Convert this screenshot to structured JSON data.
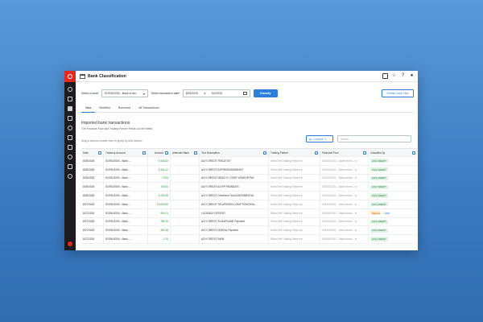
{
  "window": {
    "title": "Bank Classification",
    "toolbar_icons": [
      "calendar-icon",
      "star-icon",
      "help-icon",
      "user-icon"
    ]
  },
  "filters": {
    "bank_label": "Select a bank*",
    "bank_value": "SOFAUSON - Bank of Am...",
    "date_label": "Select transaction date*",
    "date_from": "8/23/2026",
    "date_to": "9/1/2026",
    "classify_label": "Classify",
    "publish_label": "Publish Cash Flow"
  },
  "tabs": [
    "New",
    "Modified",
    "Removed",
    "All Transactions"
  ],
  "section": {
    "title": "Imported bank transactions",
    "subtitle": "The Financial Flow and Trading Partner Fields can be edited.",
    "group_hint": "Drag a column header here to group by that column",
    "columns_label": "Columns",
    "search_placeholder": "Search"
  },
  "grid": {
    "headers": [
      "Date",
      "Treasury Account",
      "Amount",
      "Alternate Bank",
      "Text Description",
      "Trading Partner",
      "Financial Flow",
      "Classified by"
    ],
    "rows": [
      {
        "date": "8/26/2026",
        "account": "SOFAUSON - Bank ...",
        "amount": "4,004.52",
        "desc": "ACH CREDIT TRACE KIT",
        "partner": "Select the Trading Partner",
        "flow": "0151010101 - Sales reven...",
        "class": "ACH CREDIT",
        "status": "ok"
      },
      {
        "date": "8/26/2026",
        "account": "SOFAUSON - Bank ...",
        "amount": "4,444.12",
        "desc": "ACH CREDIT EXPRESS/ANDHI/INT",
        "partner": "Select the Trading Partner",
        "flow": "0151010101 - Sales reven...",
        "class": "ACH CREDIT",
        "status": "ok"
      },
      {
        "date": "8/26/2026",
        "account": "SOFAUSON - Bank ...",
        "amount": "70.84",
        "desc": "ACH CREDIT NEWCYC CORE VENDOR PAY",
        "partner": "Select the Trading Partner",
        "flow": "0151010101 - Sales reven...",
        "class": "ACH CREDIT",
        "status": "ok"
      },
      {
        "date": "8/26/2026",
        "account": "SOFAUSON - Bank ...",
        "amount": "100.51",
        "desc": "ACH CREDIT ACH/P PAYABLES",
        "partner": "Select the Trading Partner",
        "flow": "0151010101 - Sales reven...",
        "class": "ACH CREDIT",
        "status": "ok"
      },
      {
        "date": "8/26/2026",
        "account": "SOFAUSON - Bank ...",
        "amount": "1,240.99",
        "desc": "ACH CREDIT Cleveland Trust INVESMENTAL",
        "partner": "Select the Trading Partner",
        "flow": "0151010101 - Sales reven...",
        "class": "ACH CREDIT",
        "status": "ok"
      },
      {
        "date": "8/27/2026",
        "account": "SOFAUSON - Bank ...",
        "amount": "13,829.90",
        "desc": "ACH CREDIT TELUPNSEN COMP PONCHVA...",
        "partner": "Select the Trading Partner",
        "flow": "0151010101 - Sales reven...",
        "class": "ACH CREDIT",
        "status": "ok"
      },
      {
        "date": "8/27/2026",
        "account": "SOFAUSON - Bank ...",
        "amount": "994.01",
        "desc": "LOCKBOX DEPOSIT",
        "partner": "Select the Trading Partner",
        "flow": "0151010101 - Sales reven...",
        "class": "Manual",
        "status": "warn",
        "action": "Clear"
      },
      {
        "date": "8/27/2026",
        "account": "SOFAUSON - Bank ...",
        "amount": "786.20",
        "desc": "ACH CREDIT SUGARCANE Payment",
        "partner": "Select the Trading Partner",
        "flow": "0151010101 - Sales reven...",
        "class": "ACH CREDIT",
        "status": "ok"
      },
      {
        "date": "8/27/2026",
        "account": "SOFAUSON - Bank ...",
        "amount": "480.38",
        "desc": "ACH CREDIT DENTAL Payment",
        "partner": "Select the Trading Partner",
        "flow": "0151010101 - Sales reven...",
        "class": "ACH CREDIT",
        "status": "ok"
      },
      {
        "date": "8/27/2026",
        "account": "SOFAUSON - Bank ...",
        "amount": "1.76",
        "desc": "ACH CREDIT INEM",
        "partner": "Select the Trading Partner",
        "flow": "0151010101 - Sales reven...",
        "class": "ACH CREDIT",
        "status": "ok"
      }
    ]
  },
  "colors": {
    "accent": "#2b7fd6",
    "brand": "#e02a22",
    "rail": "#1c1c1f",
    "background": "#3d7dc2"
  }
}
